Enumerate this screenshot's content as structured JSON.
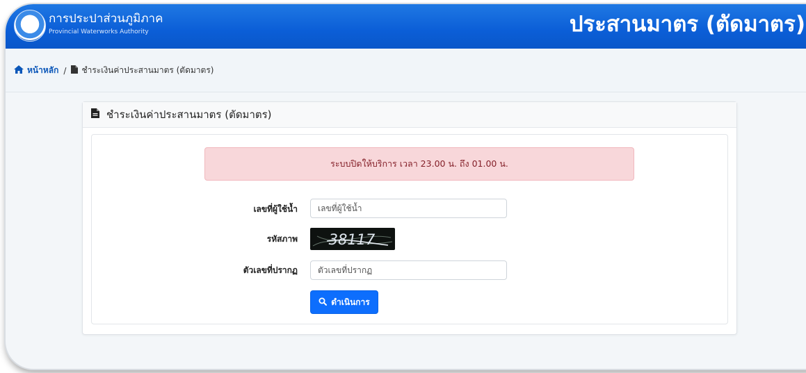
{
  "header": {
    "org_name_th": "การประปาส่วนภูมิภาค",
    "org_name_en": "Provincial Waterworks Authority",
    "page_heading": "ประสานมาตร (ตัดมาตร)",
    "logo_icon": "pwa-logo",
    "colors": {
      "primary": "#0b5ed7"
    }
  },
  "breadcrumb": {
    "home_icon": "home-icon",
    "home_label": "หน้าหลัก",
    "separator": "/",
    "current_icon": "file-icon",
    "current_label": "ชำระเงินค่าประสานมาตร (ตัดมาตร)"
  },
  "card": {
    "title_icon": "file-icon",
    "title": "ชำระเงินค่าประสานมาตร (ตัดมาตร)"
  },
  "alert": {
    "message": "ระบบปิดให้บริการ เวลา 23.00 น. ถึง 01.00 น.",
    "color": "#f8d7da"
  },
  "form": {
    "customer_no_label": "เลขที่ผู้ใช้น้ำ",
    "customer_no_placeholder": "เลขที่ผู้ใช้น้ำ",
    "captcha_label": "รหัสภาพ",
    "captcha_text": "38117",
    "answer_label": "ตัวเลขที่ปรากฏ",
    "answer_placeholder": "ตัวเลขที่ปรากฏ",
    "submit_label": "ดำเนินการ",
    "submit_icon": "search-icon",
    "submit_color": "#0d6efd"
  }
}
